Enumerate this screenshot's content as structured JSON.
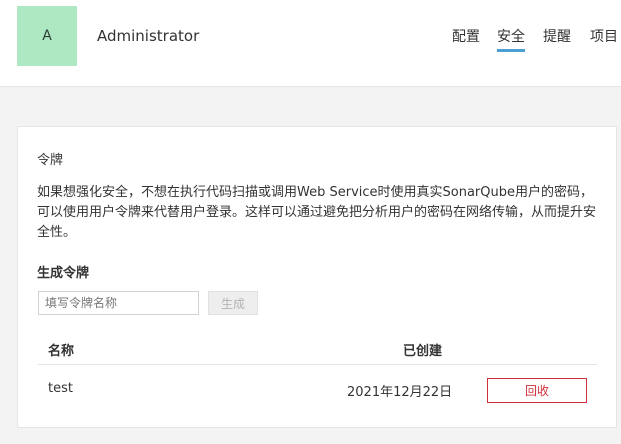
{
  "user": {
    "avatar_letter": "A",
    "name": "Administrator"
  },
  "nav": {
    "items": [
      {
        "label": "配置"
      },
      {
        "label": "安全"
      },
      {
        "label": "提醒"
      },
      {
        "label": "项目"
      }
    ],
    "active": "安全"
  },
  "panel": {
    "title": "令牌",
    "description": "如果想强化安全，不想在执行代码扫描或调用Web Service时使用真实SonarQube用户的密码，可以使用用户令牌来代替用户登录。这样可以通过避免把分析用户的密码在网络传输，从而提升安全性。",
    "generate_title": "生成令牌",
    "input_placeholder": "填写令牌名称",
    "generate_button": "生成",
    "table": {
      "columns": [
        "名称",
        "已创建"
      ],
      "rows": [
        {
          "name": "test",
          "created": "2021年12月22日",
          "action": "回收"
        }
      ]
    }
  },
  "colors": {
    "avatar_bg": "#aee8c3",
    "active_tab_underline": "#4b9fd5",
    "revoke_red": "#d02f3a"
  }
}
